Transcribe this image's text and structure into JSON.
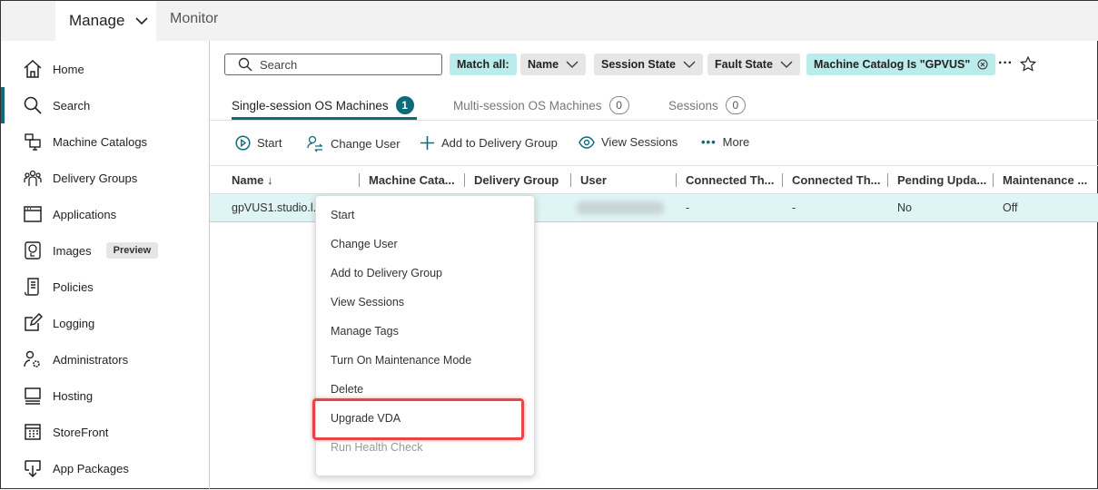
{
  "topbar": {
    "manage": "Manage",
    "monitor": "Monitor"
  },
  "sidebar": {
    "items": [
      {
        "label": "Home",
        "icon": "home-icon"
      },
      {
        "label": "Search",
        "icon": "search-icon",
        "active": true
      },
      {
        "label": "Machine Catalogs",
        "icon": "machine-catalog-icon"
      },
      {
        "label": "Delivery Groups",
        "icon": "delivery-groups-icon"
      },
      {
        "label": "Applications",
        "icon": "applications-icon"
      },
      {
        "label": "Images",
        "icon": "images-icon",
        "badge": "Preview"
      },
      {
        "label": "Policies",
        "icon": "policies-icon"
      },
      {
        "label": "Logging",
        "icon": "logging-icon"
      },
      {
        "label": "Administrators",
        "icon": "administrators-icon"
      },
      {
        "label": "Hosting",
        "icon": "hosting-icon"
      },
      {
        "label": "StoreFront",
        "icon": "storefront-icon"
      },
      {
        "label": "App Packages",
        "icon": "app-packages-icon"
      }
    ]
  },
  "search": {
    "placeholder": "Search"
  },
  "filters": {
    "match": "Match all:",
    "name": "Name",
    "session_state": "Session State",
    "fault_state": "Fault State",
    "catalog": "Machine Catalog Is \"GPVUS\""
  },
  "tabs": [
    {
      "label": "Single-session OS Machines",
      "count": "1"
    },
    {
      "label": "Multi-session OS Machines",
      "count": "0"
    },
    {
      "label": "Sessions",
      "count": "0"
    }
  ],
  "toolbar": {
    "start": "Start",
    "change_user": "Change User",
    "add": "Add to Delivery Group",
    "view": "View Sessions",
    "more": "More"
  },
  "table": {
    "columns": [
      "Name ↓",
      "Machine Cata...",
      "Delivery Group",
      "User",
      "Connected Th...",
      "Connected Th...",
      "Pending Upda...",
      "Maintenance ..."
    ],
    "rows": [
      [
        "gpVUS1.studio.l...",
        "",
        "",
        "",
        "-",
        "-",
        "No",
        "Off"
      ]
    ]
  },
  "context_menu": {
    "items": [
      "Start",
      "Change User",
      "Add to Delivery Group",
      "View Sessions",
      "Manage Tags",
      "Turn On Maintenance Mode",
      "Delete",
      "Upgrade VDA",
      "Run Health Check"
    ],
    "highlighted": "Upgrade VDA",
    "disabled": [
      "Run Health Check"
    ]
  },
  "colors": {
    "accent": "#0e6b7a",
    "highlight": "#e84646",
    "row_selected": "#dff4f5",
    "chip_teal": "#b9ecea"
  }
}
